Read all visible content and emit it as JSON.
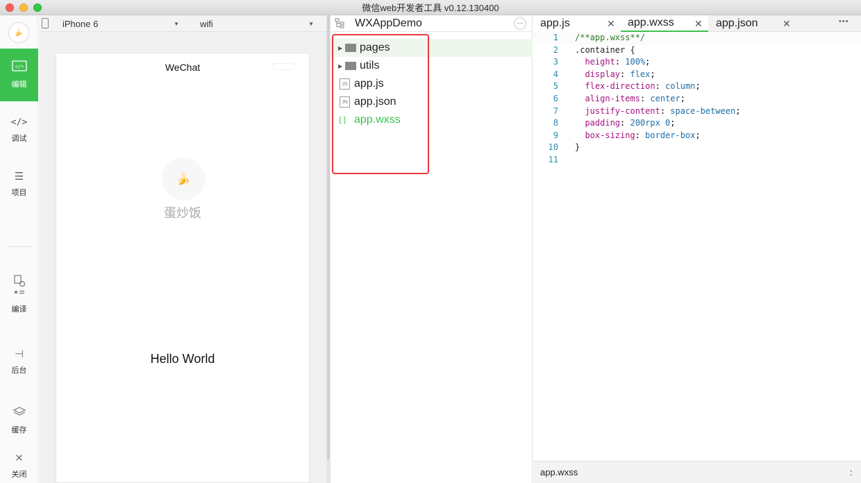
{
  "window": {
    "title": "微信web开发者工具 v0.12.130400"
  },
  "sidebar": {
    "logo_glyph": "🍌",
    "items": [
      {
        "label": "编辑",
        "icon": "code-screen-icon",
        "glyph": "▭",
        "active": true
      },
      {
        "label": "调试",
        "icon": "angle-brackets-icon",
        "glyph": "</>"
      },
      {
        "label": "项目",
        "icon": "hamburger-menu-icon",
        "glyph": "☰"
      },
      {
        "label": "编译",
        "icon": "compile-icon",
        "glyph": "⎘"
      },
      {
        "label": "后台",
        "icon": "background-icon",
        "glyph": "⊣"
      },
      {
        "label": "缓存",
        "icon": "layers-icon",
        "glyph": "≋"
      },
      {
        "label": "关闭",
        "icon": "close-icon",
        "glyph": "✕"
      }
    ]
  },
  "simulator": {
    "device": "iPhone 6",
    "network": "wifi",
    "nav_title": "WeChat",
    "avatar_glyph": "🍌",
    "nickname": "蛋炒饭",
    "body_text": "Hello World"
  },
  "file_tree": {
    "project_name": "WXAppDemo",
    "more_glyph": "···",
    "items": [
      {
        "name": "pages",
        "type": "folder",
        "badge": ""
      },
      {
        "name": "utils",
        "type": "folder",
        "badge": ""
      },
      {
        "name": "app.js",
        "type": "file",
        "badge": "JS"
      },
      {
        "name": "app.json",
        "type": "file",
        "badge": "JN"
      },
      {
        "name": "app.wxss",
        "type": "file",
        "badge": "{ }",
        "active": true
      }
    ]
  },
  "editor": {
    "tabs": [
      {
        "label": "app.js"
      },
      {
        "label": "app.wxss",
        "active": true
      },
      {
        "label": "app.json"
      }
    ],
    "more_glyph": "•••",
    "code_lines": [
      {
        "n": "1",
        "t": "/**app.wxss**/"
      },
      {
        "n": "2",
        "t": ".container {"
      },
      {
        "n": "3",
        "t": "  height: 100%;"
      },
      {
        "n": "4",
        "t": "  display: flex;"
      },
      {
        "n": "5",
        "t": "  flex-direction: column;"
      },
      {
        "n": "6",
        "t": "  align-items: center;"
      },
      {
        "n": "7",
        "t": "  justify-content: space-between;"
      },
      {
        "n": "8",
        "t": "  padding: 200rpx 0;"
      },
      {
        "n": "9",
        "t": "  box-sizing: border-box;"
      },
      {
        "n": "10",
        "t": "}"
      },
      {
        "n": "11",
        "t": ""
      }
    ],
    "status_file": "app.wxss",
    "status_right": ":"
  },
  "colors": {
    "accent": "#3cc151",
    "highlight_box": "#e8363d",
    "comment": "#2d7d2d",
    "keyword": "#a5127f",
    "value": "#1b6ea8",
    "line_number": "#2a8cb3"
  }
}
